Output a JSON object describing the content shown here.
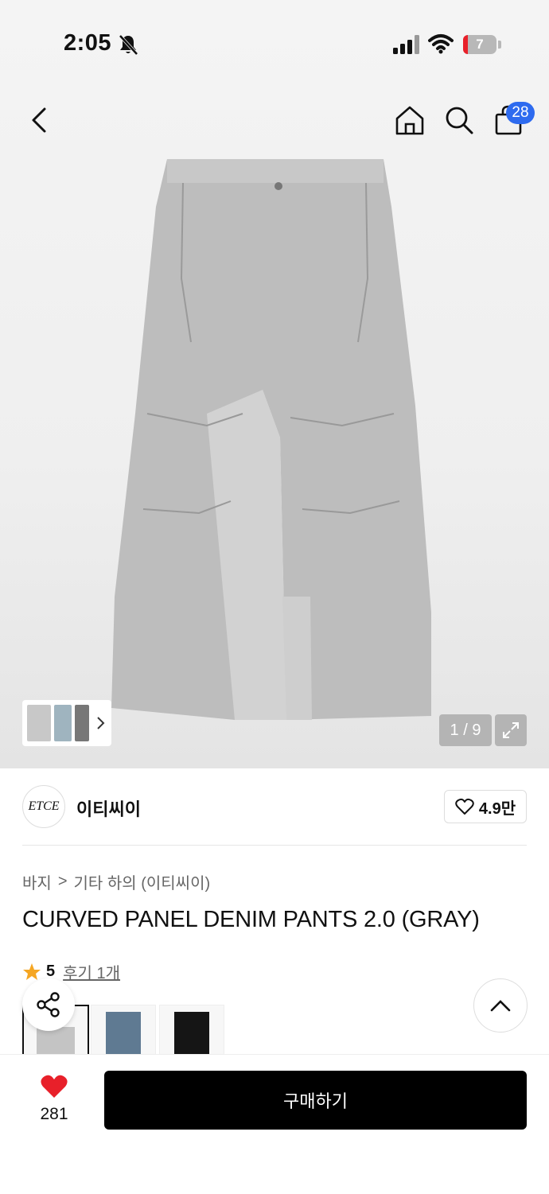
{
  "status_bar": {
    "time": "2:05",
    "battery": "7"
  },
  "header": {
    "cart_count": "28"
  },
  "gallery": {
    "counter": "1 / 9"
  },
  "brand": {
    "logo_text": "ETCE",
    "name": "이티씨이",
    "likes": "4.9만"
  },
  "breadcrumb": {
    "category": "바지",
    "separator": ">",
    "subcategory": "기타 하의 (이티씨이)"
  },
  "product": {
    "title": "CURVED PANEL DENIM PANTS 2.0 (GRAY)",
    "rating": "5",
    "review_link": "후기 1개"
  },
  "bottom_bar": {
    "heart_count": "281",
    "buy_label": "구매하기"
  },
  "colors": {
    "accent_blue": "#2e6bef",
    "heart_red": "#e8202a",
    "star": "#f5a623"
  }
}
